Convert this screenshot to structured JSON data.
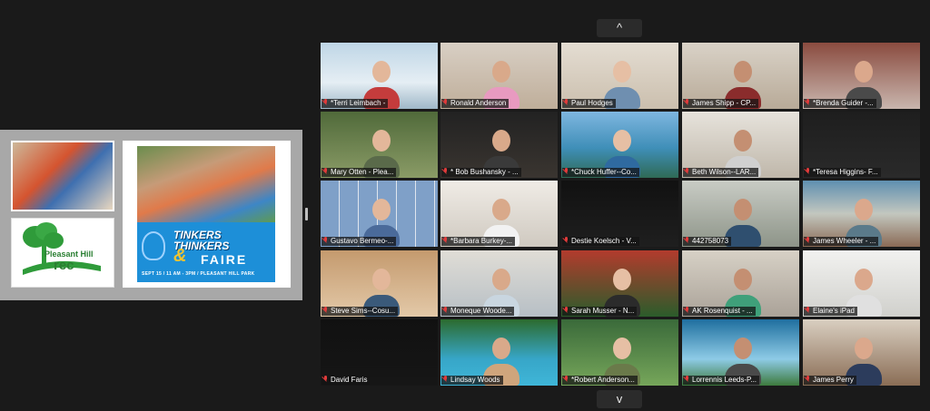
{
  "share": {
    "org_name": "Pleasant Hill",
    "org_rec": "rec",
    "flyer_title": "TINKERS THINKERS",
    "flyer_amp": "&",
    "flyer_faire": "FAIRE",
    "flyer_date": "SEPT 15 / 11 AM - 3PM / PLEASANT HILL PARK"
  },
  "nav": {
    "up": "^",
    "down": "v"
  },
  "participants": [
    {
      "name": "*Terri Leimbach -"
    },
    {
      "name": "Ronald Anderson"
    },
    {
      "name": "Paul Hodges"
    },
    {
      "name": "James Shipp - CP..."
    },
    {
      "name": "*Brenda Guider -..."
    },
    {
      "name": "Mary Otten - Plea..."
    },
    {
      "name": "* Bob Bushansky - ..."
    },
    {
      "name": "*Chuck Huffer--Co..."
    },
    {
      "name": "Beth Wilson--LAR..."
    },
    {
      "name": "*Teresa Higgins- F..."
    },
    {
      "name": "Gustavo Bermeo-..."
    },
    {
      "name": "*Barbara Burkey-..."
    },
    {
      "name": "Destie Koelsch - V..."
    },
    {
      "name": "442758073"
    },
    {
      "name": "James Wheeler - ..."
    },
    {
      "name": "Steve Sims--Cosu..."
    },
    {
      "name": "Moneque Woode..."
    },
    {
      "name": "Sarah Musser - N..."
    },
    {
      "name": "AK Rosenquist - ..."
    },
    {
      "name": "Elaine's iPad"
    },
    {
      "name": "David Faris"
    },
    {
      "name": "Lindsay Woods"
    },
    {
      "name": "*Robert Anderson..."
    },
    {
      "name": "Lorrennis Leeds-P..."
    },
    {
      "name": "James Perry"
    }
  ],
  "colors": {
    "background": "#1a1a1a",
    "muted_mic": "#e13b3b",
    "name_bg": "#141414"
  }
}
